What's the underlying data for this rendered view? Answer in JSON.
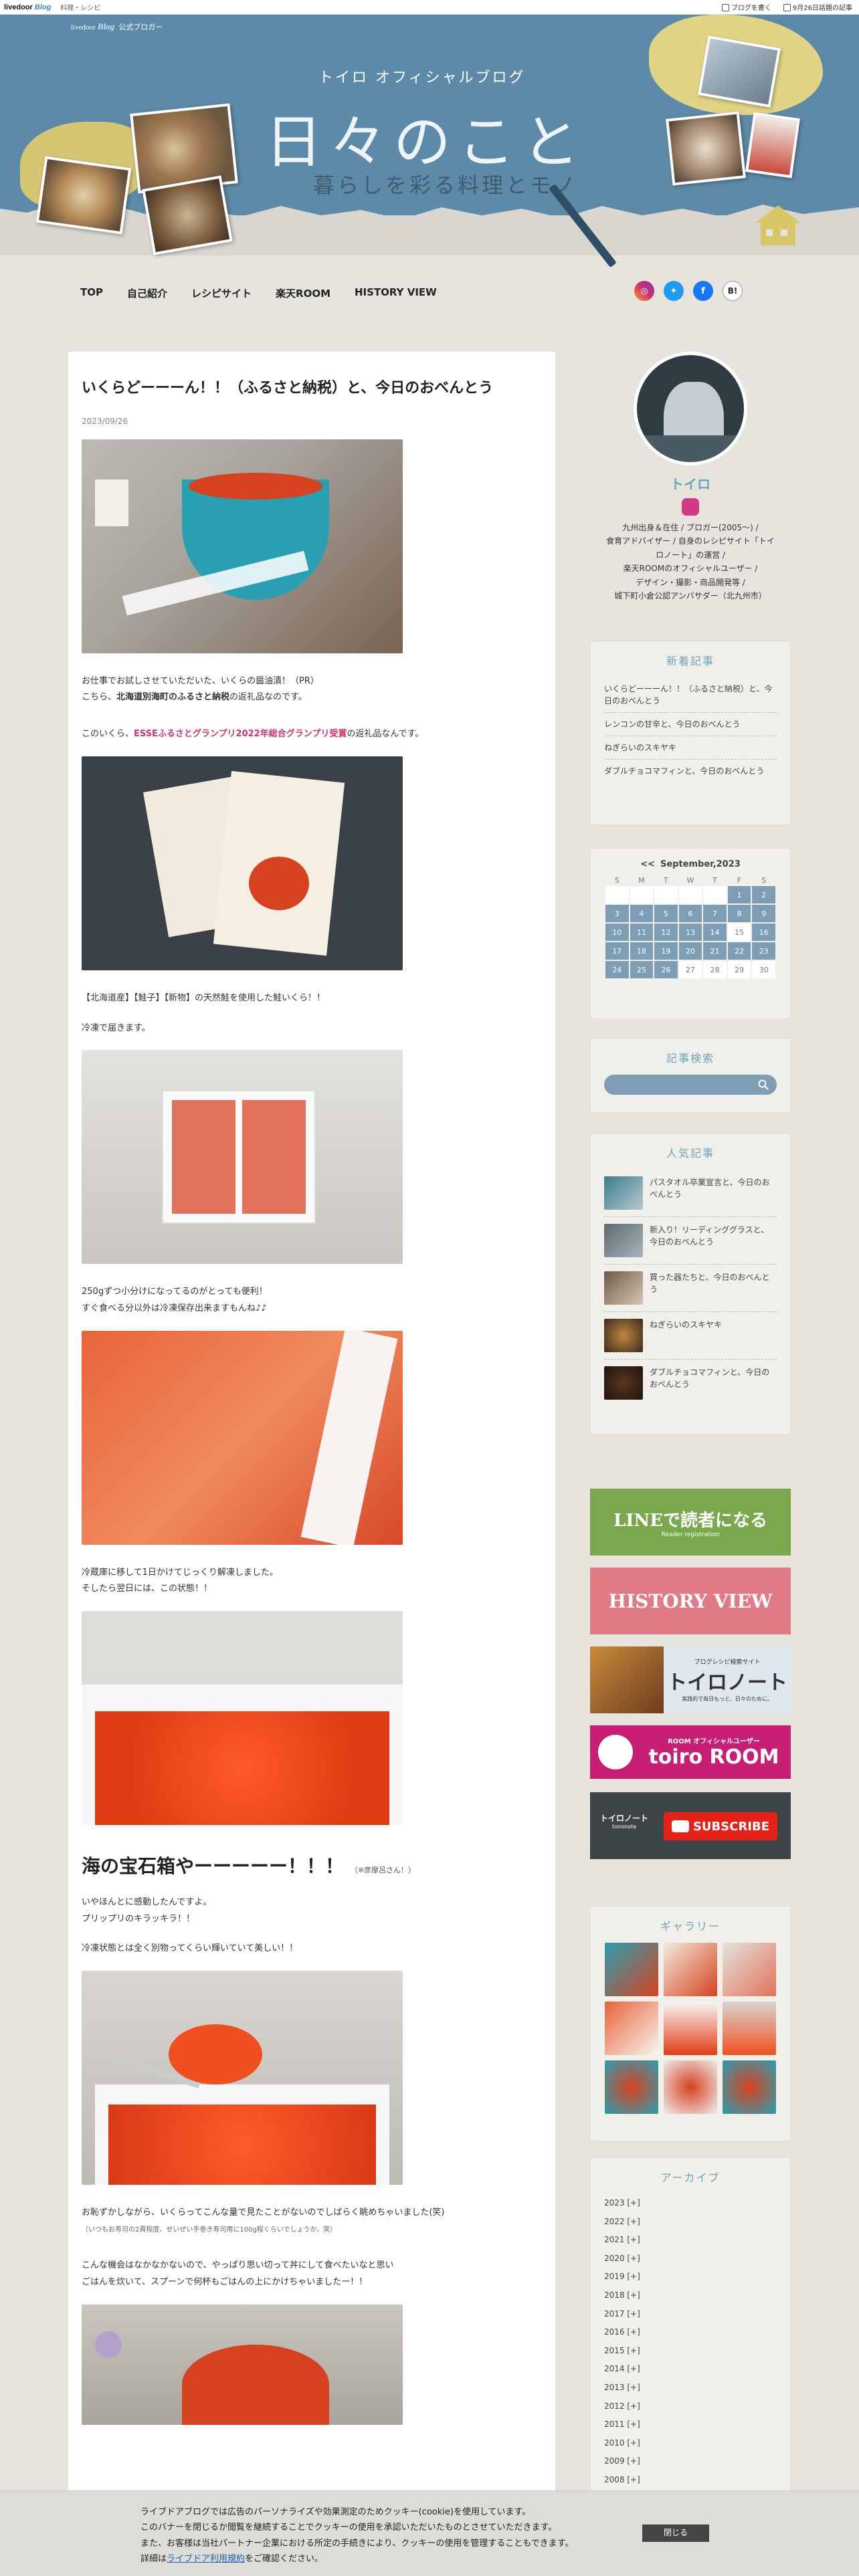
{
  "topbar": {
    "logo_a": "livedoor",
    "logo_b": "Blog",
    "category": "料理・レシピ",
    "write_label": "ブログを書く",
    "topic_label": "9月26日話題の記事"
  },
  "header": {
    "blog_logo_a": "livedoor",
    "blog_logo_b": "Blog",
    "blog_logo_c": "公式ブロガー",
    "subtitle": "トイロ オフィシャルブログ",
    "title": "日々のこと",
    "tagline": "暮らしを彩る料理とモノ"
  },
  "nav": [
    "TOP",
    "自己紹介",
    "レシピサイト",
    "楽天ROOM",
    "HISTORY VIEW"
  ],
  "social": [
    "instagram-icon",
    "twitter-icon",
    "facebook-icon",
    "hatena-icon"
  ],
  "post": {
    "title": "いくらどーーーん！！（ふるさと納税）と、今日のおべんとう",
    "date": "2023/09/26",
    "p1_line1": "お仕事でお試しさせていただいた、いくらの醤油漬！（PR）",
    "p1_line2_a": "こちら、",
    "p1_line2_b": "北海道別海町のふるさと納税",
    "p1_line2_c": "の返礼品なのです。",
    "p2_a": "このいくら、",
    "p2_b": "ESSEふるさとグランプリ2022年総合グランプリ受賞",
    "p2_c": "の返礼品なんです。",
    "p3": "【北海道産】【鮭子】【新物】の天然鮭を使用した鮭いくら！！",
    "p4": "冷凍で届きます。",
    "p5_line1": "250gずつ小分けになってるのがとっても便利！",
    "p5_line2": "すぐ食べる分以外は冷凍保存出来ますもんね♪♪",
    "p6_line1": "冷蔵庫に移して1日かけてじっくり解凍しました。",
    "p6_line2": "そしたら翌日には、この状態！！",
    "h2": "海の宝石箱やーーーーー！！！",
    "h2_note": "（※彦摩呂さん！）",
    "p7_line1": "いやほんとに感動したんですよ。",
    "p7_line2": "プリップリのキラッキラ！！",
    "p8": "冷凍状態とは全く別物ってくらい輝いていて美しい！！",
    "p9_line1": "お恥ずかしながら、いくらってこんな量で見たことがないのでしばらく眺めちゃいました(笑)",
    "p9_note": "（いつもお寿司の2貫程度、せいぜい手巻き寿司用に100g程くらいでしょうか。笑）",
    "p10_line1": "こんな機会はなかなかないので、やっぱり思い切って丼にして食べたいなと思い",
    "p10_line2": "ごはんを炊いて、スプーンで何杯もごはんの上にかけちゃいましたー！！"
  },
  "profile": {
    "name": "トイロ",
    "desc": [
      "九州出身＆在住 / ブロガー(2005〜) /",
      "食育アドバイザー / 自身のレシピサイト「トイ",
      "ロノート」の運営 /",
      "楽天ROOMのオフィシャルユーザー /",
      "デザイン・撮影・商品開発等 /",
      "城下町小倉公認アンバサダー（北九州市）"
    ]
  },
  "recent": {
    "title": "新着記事",
    "items": [
      "いくらどーーーん！！（ふるさと納税）と、今日のおべんとう",
      "レンコンの甘辛と、今日のおべんとう",
      "ねぎらいのスキヤキ",
      "ダブルチョコマフィンと、今日のおべんとう"
    ]
  },
  "calendar": {
    "prev": "<<",
    "title": "September,2023",
    "days": [
      "S",
      "M",
      "T",
      "W",
      "T",
      "F",
      "S"
    ],
    "weeks": [
      [
        "",
        "",
        "",
        "",
        "",
        "1",
        "2"
      ],
      [
        "3",
        "4",
        "5",
        "6",
        "7",
        "8",
        "9"
      ],
      [
        "10",
        "11",
        "12",
        "13",
        "14",
        "15",
        "16"
      ],
      [
        "17",
        "18",
        "19",
        "20",
        "21",
        "22",
        "23"
      ],
      [
        "24",
        "25",
        "26",
        "27",
        "28",
        "29",
        "30"
      ]
    ]
  },
  "search": {
    "title": "記事検索"
  },
  "popular": {
    "title": "人気記事",
    "items": [
      "パスタオル卒業宣言と、今日のおべんとう",
      "新入り！リーディンググラスと、今日のおべんとう",
      "買った器たちと、今日のおべんとう",
      "ねぎらいのスキヤキ",
      "ダブルチョコマフィンと、今日のおべんとう"
    ]
  },
  "banners": {
    "line_title": "LINEで読者になる",
    "line_sub": "Reader registration",
    "history": "HISTORY VIEW",
    "toiro_note_small": "ブログレシピ検索サイト",
    "toiro_note": "トイロノート",
    "toiro_note_sub": "実践的で毎日もっと、日々のために。",
    "room_small": "ROOM オフィシャルユーザー",
    "room": "toiro ROOM",
    "yt_left": "トイロノート",
    "yt_left_sub": "toironote",
    "yt": "SUBSCRIBE"
  },
  "gallery": {
    "title": "ギャラリー"
  },
  "archive": {
    "title": "アーカイブ",
    "years": [
      "2023 [+]",
      "2022 [+]",
      "2021 [+]",
      "2020 [+]",
      "2019 [+]",
      "2018 [+]",
      "2017 [+]",
      "2016 [+]",
      "2015 [+]",
      "2014 [+]",
      "2013 [+]",
      "2012 [+]",
      "2011 [+]",
      "2010 [+]",
      "2009 [+]",
      "2008 [+]"
    ]
  },
  "cookie": {
    "line1": "ライブドアブログでは広告のパーソナライズや効果測定のためクッキー(cookie)を使用しています。",
    "line2": "このバナーを閉じるか閲覧を継続することでクッキーの使用を承認いただいたものとさせていただきます。",
    "line3": "また、お客様は当社パートナー企業における所定の手続きにより、クッキーの使用を管理することもできます。",
    "line4_a": "詳細は",
    "line4_link": "ライブドア利用規約",
    "line4_b": "をご確認ください。",
    "close": "閉じる"
  },
  "colors": {
    "header_blue": "#5d8aa8",
    "accent": "#6fa2bb",
    "pink": "#d4346a",
    "calendar_blue": "#7e9eb5"
  }
}
